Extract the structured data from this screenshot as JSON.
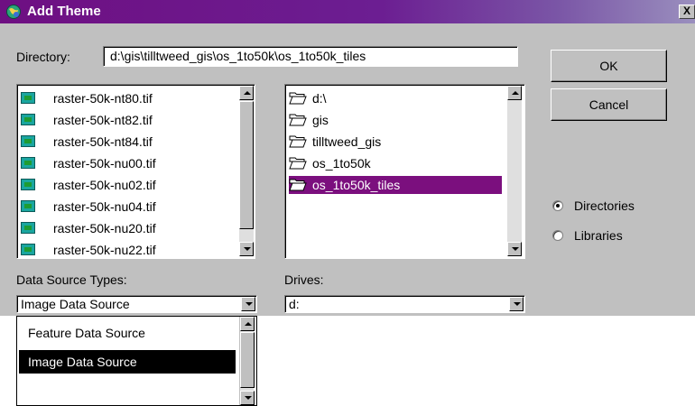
{
  "window": {
    "title": "Add Theme",
    "close_label": "X"
  },
  "directory": {
    "label": "Directory:",
    "value": "d:\\gis\\tilltweed_gis\\os_1to50k\\os_1to50k_tiles"
  },
  "buttons": {
    "ok": "OK",
    "cancel": "Cancel"
  },
  "files": [
    "raster-50k-nt80.tif",
    "raster-50k-nt82.tif",
    "raster-50k-nt84.tif",
    "raster-50k-nu00.tif",
    "raster-50k-nu02.tif",
    "raster-50k-nu04.tif",
    "raster-50k-nu20.tif",
    "raster-50k-nu22.tif"
  ],
  "folders": {
    "items": [
      "d:\\",
      "gis",
      "tilltweed_gis",
      "os_1to50k",
      "os_1to50k_tiles"
    ],
    "selected": "os_1to50k_tiles"
  },
  "radio": {
    "directories": "Directories",
    "libraries": "Libraries",
    "selected": "Directories"
  },
  "data_source": {
    "label": "Data Source Types:",
    "value": "Image Data Source",
    "options": [
      "Feature Data Source",
      "Image Data Source"
    ],
    "highlighted": "Image Data Source"
  },
  "drives": {
    "label": "Drives:",
    "value": "d:"
  },
  "colors": {
    "title_bar": "#6e0f82",
    "selection": "#7b0f7e",
    "dropdown_highlight": "#000000",
    "dialog_bg": "#c0c0c0"
  }
}
